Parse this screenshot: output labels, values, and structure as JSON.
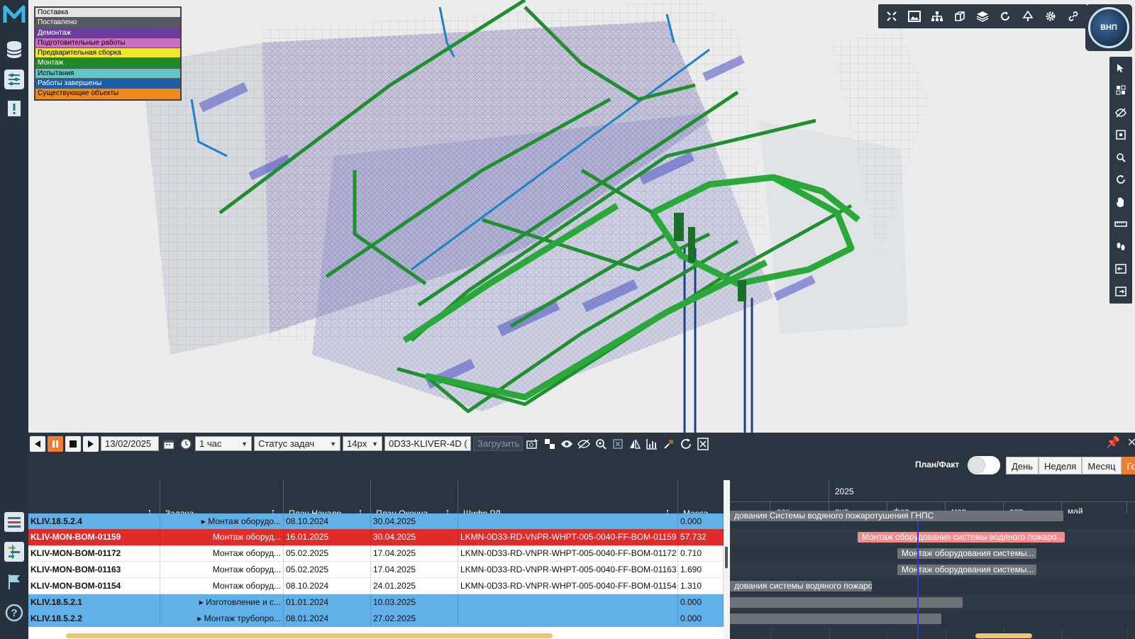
{
  "legend": [
    {
      "label": "Поставка",
      "color": "#e3e3e3",
      "text": "#000"
    },
    {
      "label": "Поставлено",
      "color": "#555a60",
      "text": "#fff"
    },
    {
      "label": "Демонтаж",
      "color": "#6b3b9e",
      "text": "#fff"
    },
    {
      "label": "Подготовительные работы",
      "color": "#cc6fc0",
      "text": "#000"
    },
    {
      "label": "Предварительная сборка",
      "color": "#f0e62b",
      "text": "#000"
    },
    {
      "label": "Монтаж",
      "color": "#1e8a2c",
      "text": "#fff"
    },
    {
      "label": "Испытания",
      "color": "#5fc6c6",
      "text": "#000"
    },
    {
      "label": "Работы завершены",
      "color": "#1c5fa8",
      "text": "#fff"
    },
    {
      "label": "Существующие объекты",
      "color": "#f08a1e",
      "text": "#000"
    }
  ],
  "avatar": {
    "label": "ВНП"
  },
  "toolbar": {
    "icons": [
      "collapse-icon",
      "image-icon",
      "hierarchy-icon",
      "cube-icon",
      "layers-icon",
      "rotate-icon",
      "tree-icon",
      "gear-icon",
      "link-icon"
    ]
  },
  "side_tools": [
    "select-icon",
    "tiles-icon",
    "hide-icon",
    "fit-icon",
    "search-zoom-icon",
    "orbit-icon",
    "pan-hand-icon",
    "measure-icon",
    "walk-icon",
    "left-panel-icon",
    "right-panel-icon"
  ],
  "playback": {
    "date": "13/02/2025",
    "step": "1 час",
    "mode": "Статус задач",
    "font_size": "14px",
    "model": "0D33-KLIVER-4D (",
    "load_label": "Загрузить"
  },
  "view": {
    "planfact_label": "План/Факт",
    "scales": [
      "День",
      "Неделя",
      "Месяц",
      "Год"
    ],
    "active_scale": "Год"
  },
  "grid": {
    "headers": [
      "",
      "Задача",
      "План Начало",
      "План Оконча...",
      "Шифр РД",
      "Масса"
    ],
    "rows": [
      {
        "style": "blue",
        "id": "KLIV.18.5.2.4",
        "task": "▸ Монтаж оборудо...",
        "start": "08.10.2024",
        "end": "30.04.2025",
        "code": "",
        "mass": "0.000"
      },
      {
        "style": "red",
        "id": "KLIV-MON-BOM-01159",
        "task": "Монтаж оборуд...",
        "start": "16.01.2025",
        "end": "30.04.2025",
        "code": "LKMN-0D33-RD-VNPR-WHPT-005-0040-FF-BOM-01159",
        "mass": "57.732"
      },
      {
        "style": "white",
        "id": "KLIV-MON-BOM-01172",
        "task": "Монтаж оборуд...",
        "start": "05.02.2025",
        "end": "17.04.2025",
        "code": "LKMN-0D33-RD-VNPR-WHPT-005-0040-FF-BOM-01172",
        "mass": "0.710"
      },
      {
        "style": "white",
        "id": "KLIV-MON-BOM-01163",
        "task": "Монтаж оборуд...",
        "start": "05.02.2025",
        "end": "17.04.2025",
        "code": "LKMN-0D33-RD-VNPR-WHPT-005-0040-FF-BOM-01163",
        "mass": "1.690"
      },
      {
        "style": "white",
        "id": "KLIV-MON-BOM-01154",
        "task": "Монтаж оборуд...",
        "start": "08.10.2024",
        "end": "24.01.2025",
        "code": "LKMN-0D33-RD-VNPR-WHPT-005-0040-FF-BOM-01154",
        "mass": "1.310"
      },
      {
        "style": "blue",
        "id": "KLIV.18.5.2.1",
        "task": "▸ Изготовление и с...",
        "start": "01.01.2024",
        "end": "10.03.2025",
        "code": "",
        "mass": "0.000"
      },
      {
        "style": "blue",
        "id": "KLIV.18.5.2.2",
        "task": "▸ Монтаж трубопро...",
        "start": "08.01.2024",
        "end": "27.02.2025",
        "code": "",
        "mass": "0.000"
      }
    ]
  },
  "gantt": {
    "year": "2025",
    "months": [
      "",
      "дек",
      "янв",
      "фев",
      "мар",
      "апр",
      "май"
    ],
    "bars": [
      {
        "row": 0,
        "label": "дования Системы водяного пожаротушения ГНПС",
        "color": "#6c7277"
      },
      {
        "row": 1,
        "label": "Монтаж оборудования системы водяного пожаро...",
        "color": "#f08c8c"
      },
      {
        "row": 2,
        "label": "Монтаж оборудования системы...",
        "color": "#6c7277"
      },
      {
        "row": 3,
        "label": "Монтаж оборудования системы...",
        "color": "#6c7277"
      },
      {
        "row": 4,
        "label": "дования системы водяного пожаро...",
        "color": "#6c7277"
      },
      {
        "row": 5,
        "label": "",
        "color": "#6c7277"
      },
      {
        "row": 6,
        "label": "",
        "color": "#6c7277"
      }
    ]
  }
}
